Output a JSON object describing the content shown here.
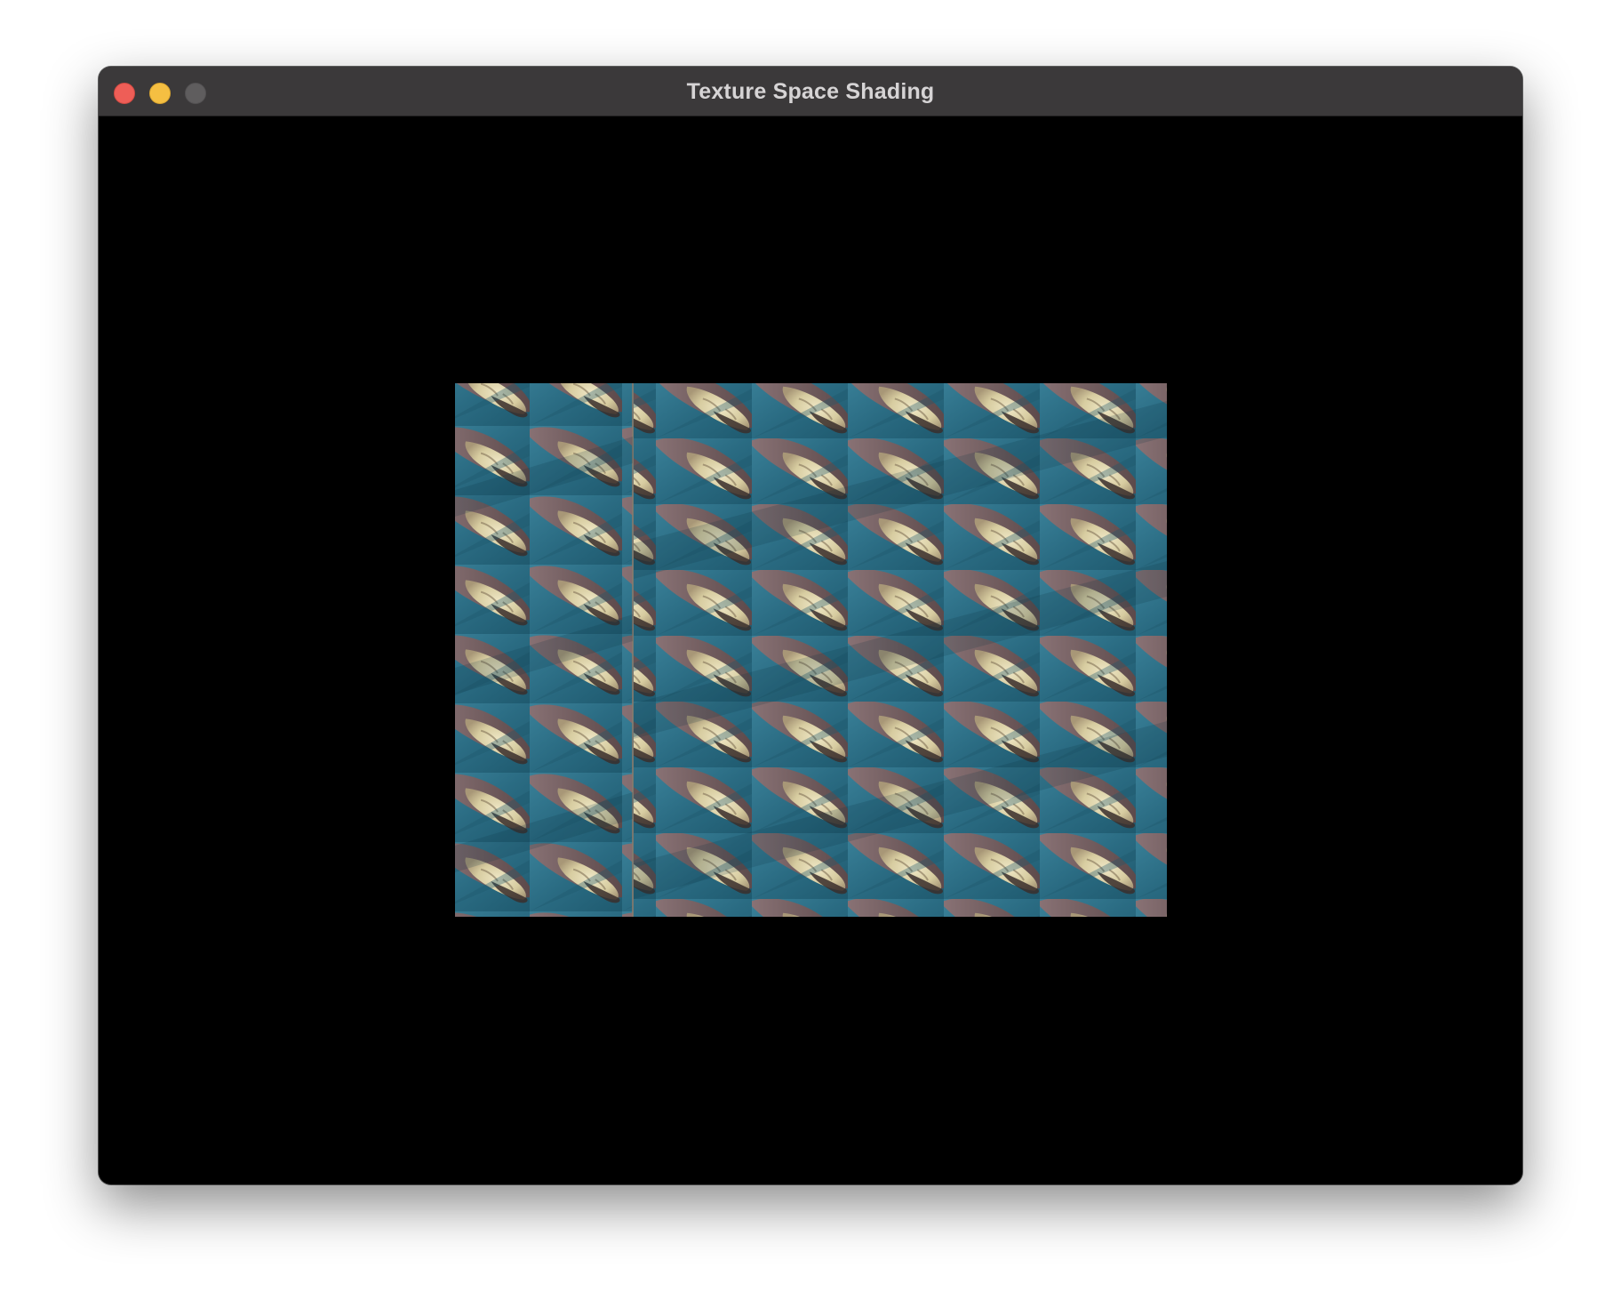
{
  "window": {
    "title": "Texture Space Shading"
  },
  "controls": {
    "close_icon": "close-icon",
    "minimize_icon": "minimize-icon",
    "zoom_icon": "zoom-icon"
  },
  "render": {
    "description_colors": {
      "water": "#2d6f86",
      "water_dark": "#1d5569",
      "sand": "#d8cfa8",
      "rock": "#6e5a5c",
      "dark_rock": "#3a2e2c",
      "window_bg": "#000000",
      "titlebar": "#3b393a"
    }
  }
}
